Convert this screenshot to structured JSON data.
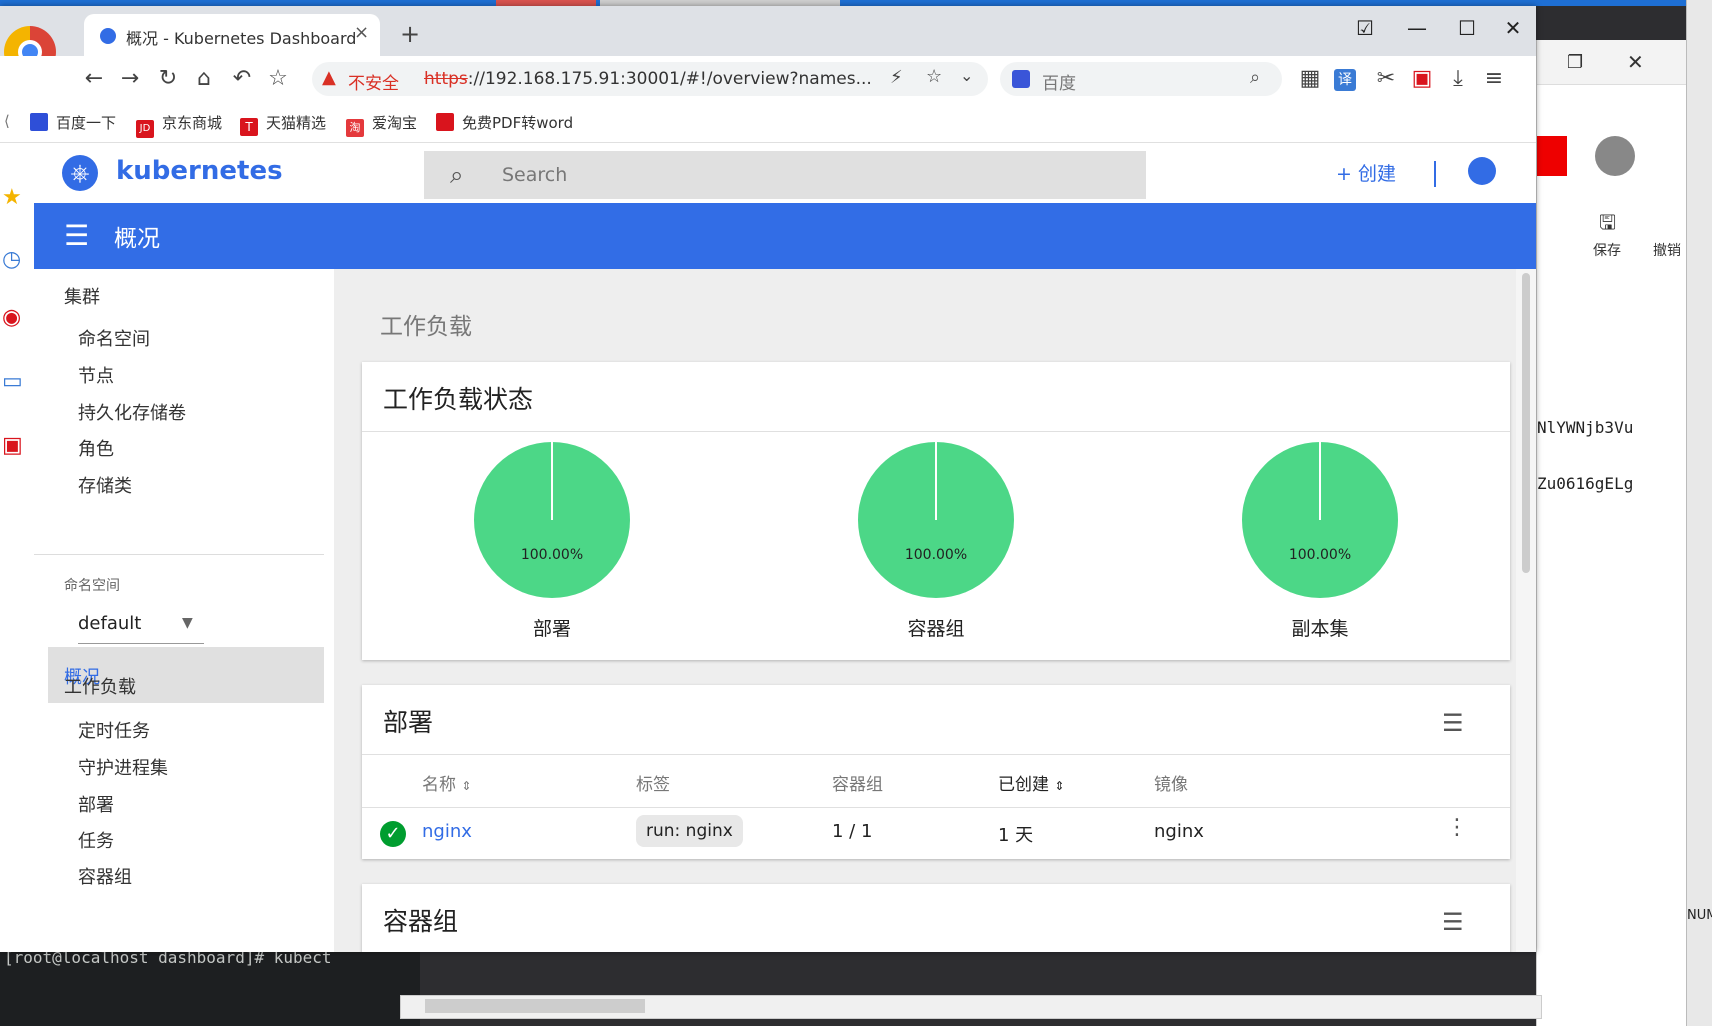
{
  "browser": {
    "tab_title": "概况 - Kubernetes Dashboard",
    "tab_close": "×",
    "new_tab": "+",
    "security_label": "不安全",
    "url_scheme": "https",
    "url_rest": "://192.168.175.91:30001/#!/overview?names...",
    "search_engine_label": "百度",
    "bookmarks": [
      "百度一下",
      "京东商城",
      "天猫精选",
      "爱淘宝",
      "免费PDF转word"
    ],
    "bookmark_colors": [
      "#2e4fd8",
      "#d9141d",
      "#d9141d",
      "#e4393c",
      "#d9141d"
    ],
    "bookmark_icon_letters": [
      "",
      "JD",
      "T",
      "淘",
      ""
    ]
  },
  "k8s": {
    "brand": "kubernetes",
    "search_placeholder": "Search",
    "create_label": "+ 创建",
    "page_title": "概况",
    "nav": {
      "cluster_section": "集群",
      "cluster_items": [
        "命名空间",
        "节点",
        "持久化存储卷",
        "角色",
        "存储类"
      ],
      "namespace_label": "命名空间",
      "namespace_value": "default",
      "active_item": "概况",
      "workloads_section": "工作负载",
      "workload_items": [
        "定时任务",
        "守护进程集",
        "部署",
        "任务",
        "容器组"
      ]
    },
    "main": {
      "section_title": "工作负载",
      "status_card_title": "工作负载状态",
      "pies": [
        {
          "name": "部署",
          "percent": "100.00%",
          "value": 1.0
        },
        {
          "name": "容器组",
          "percent": "100.00%",
          "value": 1.0
        },
        {
          "name": "副本集",
          "percent": "100.00%",
          "value": 1.0
        }
      ],
      "deploy_card_title": "部署",
      "columns": [
        "名称",
        "标签",
        "容器组",
        "已创建",
        "镜像"
      ],
      "row": {
        "name": "nginx",
        "label": "run: nginx",
        "pods": "1 / 1",
        "created": "1 天",
        "image": "nginx"
      },
      "pods_card_title": "容器组"
    }
  },
  "terminal_text": "[root@localhost dashboard]#  kubect",
  "side_window": {
    "text1": "NlYWNjb3Vu",
    "text2": "Zu0616gELg",
    "save_label": "保存",
    "undo_label": "撤销",
    "num_label": "NUM"
  },
  "colors": {
    "k8s_blue": "#326ce5",
    "pie_green": "#4cd787",
    "ok_green": "#009d2f"
  }
}
